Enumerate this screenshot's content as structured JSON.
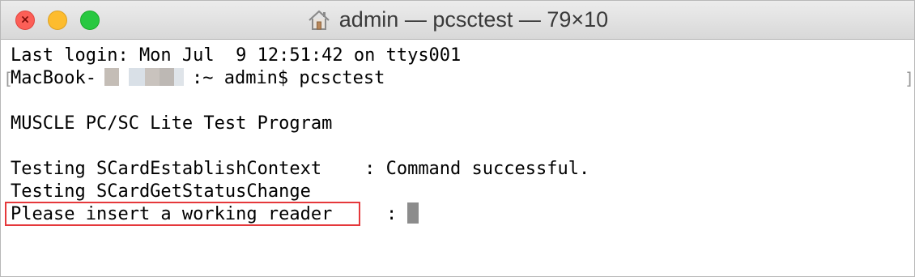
{
  "window": {
    "title": "admin — pcsctest — 79×10",
    "title_icon": "home-icon",
    "traffic_lights": {
      "close_color": "#fc5f57",
      "minimize_color": "#fdbc2e",
      "maximize_color": "#28c840",
      "close_glyph": "×"
    }
  },
  "terminal": {
    "lines": [
      "Last login: Mon Jul  9 12:51:42 on ttys001",
      "MacBook-",
      ":~ admin$ pcsctest",
      "MUSCLE PC/SC Lite Test Program",
      "Testing SCardEstablishContext    : Command successful.",
      "Testing SCardGetStatusChange",
      "Please insert a working reader",
      ":"
    ],
    "selection_marks": [
      "[",
      "]"
    ],
    "highlight_color": "#e5383b",
    "cursor_color": "#8c8c8c"
  }
}
